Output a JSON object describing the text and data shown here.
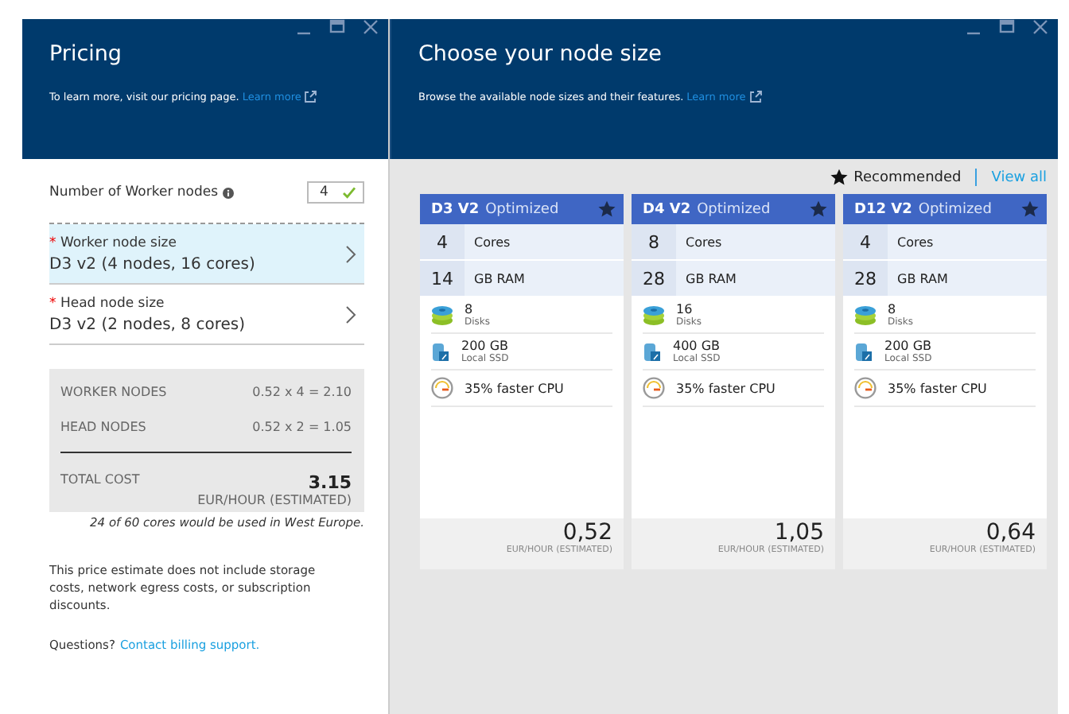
{
  "pricing": {
    "title": "Pricing",
    "intro": "To learn more, visit our pricing page.",
    "intro_link": "Learn more",
    "worker_count": {
      "label": "Number of Worker nodes",
      "value": "4",
      "valid": true
    },
    "node_sizes": [
      {
        "marker": "*",
        "label": "Worker node size",
        "value": "D3 v2 (4 nodes, 16 cores)",
        "selected": true
      },
      {
        "marker": "*",
        "label": "Head node size",
        "value": "D3 v2 (2 nodes, 8 cores)",
        "selected": false
      }
    ],
    "cost_lines": [
      {
        "label": "WORKER NODES",
        "value": "0.52 x 4 = 2.10"
      },
      {
        "label": "HEAD NODES",
        "value": "0.52 x 2 = 1.05"
      }
    ],
    "total": {
      "label": "TOTAL COST",
      "value": "3.15",
      "unit": "EUR/HOUR (ESTIMATED)"
    },
    "cores_note": "24 of 60 cores would be used in West Europe.",
    "disclaimer": "This price estimate does not include storage costs, network egress costs, or subscription discounts.",
    "questions": "Questions?",
    "support_link": "Contact billing support."
  },
  "node_size": {
    "title": "Choose your node size",
    "intro": "Browse the available node sizes and their features.",
    "intro_link": "Learn more",
    "recommended_label": "Recommended",
    "view_all": "View all",
    "cards": [
      {
        "name": "D3 V2",
        "tag": "Optimized",
        "recommended": true,
        "cores": "4",
        "cores_label": "Cores",
        "ram": "14",
        "ram_label": "GB RAM",
        "features": [
          {
            "kind": "disks",
            "value": "8",
            "label": "Disks"
          },
          {
            "kind": "ssd",
            "value": "200 GB",
            "label": "Local SSD"
          },
          {
            "kind": "cpu",
            "value": "35% faster CPU"
          }
        ],
        "price": "0,52",
        "unit": "EUR/HOUR (ESTIMATED)"
      },
      {
        "name": "D4 V2",
        "tag": "Optimized",
        "recommended": true,
        "cores": "8",
        "cores_label": "Cores",
        "ram": "28",
        "ram_label": "GB RAM",
        "features": [
          {
            "kind": "disks",
            "value": "16",
            "label": "Disks"
          },
          {
            "kind": "ssd",
            "value": "400 GB",
            "label": "Local SSD"
          },
          {
            "kind": "cpu",
            "value": "35% faster CPU"
          }
        ],
        "price": "1,05",
        "unit": "EUR/HOUR (ESTIMATED)"
      },
      {
        "name": "D12 V2",
        "tag": "Optimized",
        "recommended": true,
        "cores": "4",
        "cores_label": "Cores",
        "ram": "28",
        "ram_label": "GB RAM",
        "features": [
          {
            "kind": "disks",
            "value": "8",
            "label": "Disks"
          },
          {
            "kind": "ssd",
            "value": "200 GB",
            "label": "Local SSD"
          },
          {
            "kind": "cpu",
            "value": "35% faster CPU"
          }
        ],
        "price": "0,64",
        "unit": "EUR/HOUR (ESTIMATED)"
      }
    ]
  }
}
